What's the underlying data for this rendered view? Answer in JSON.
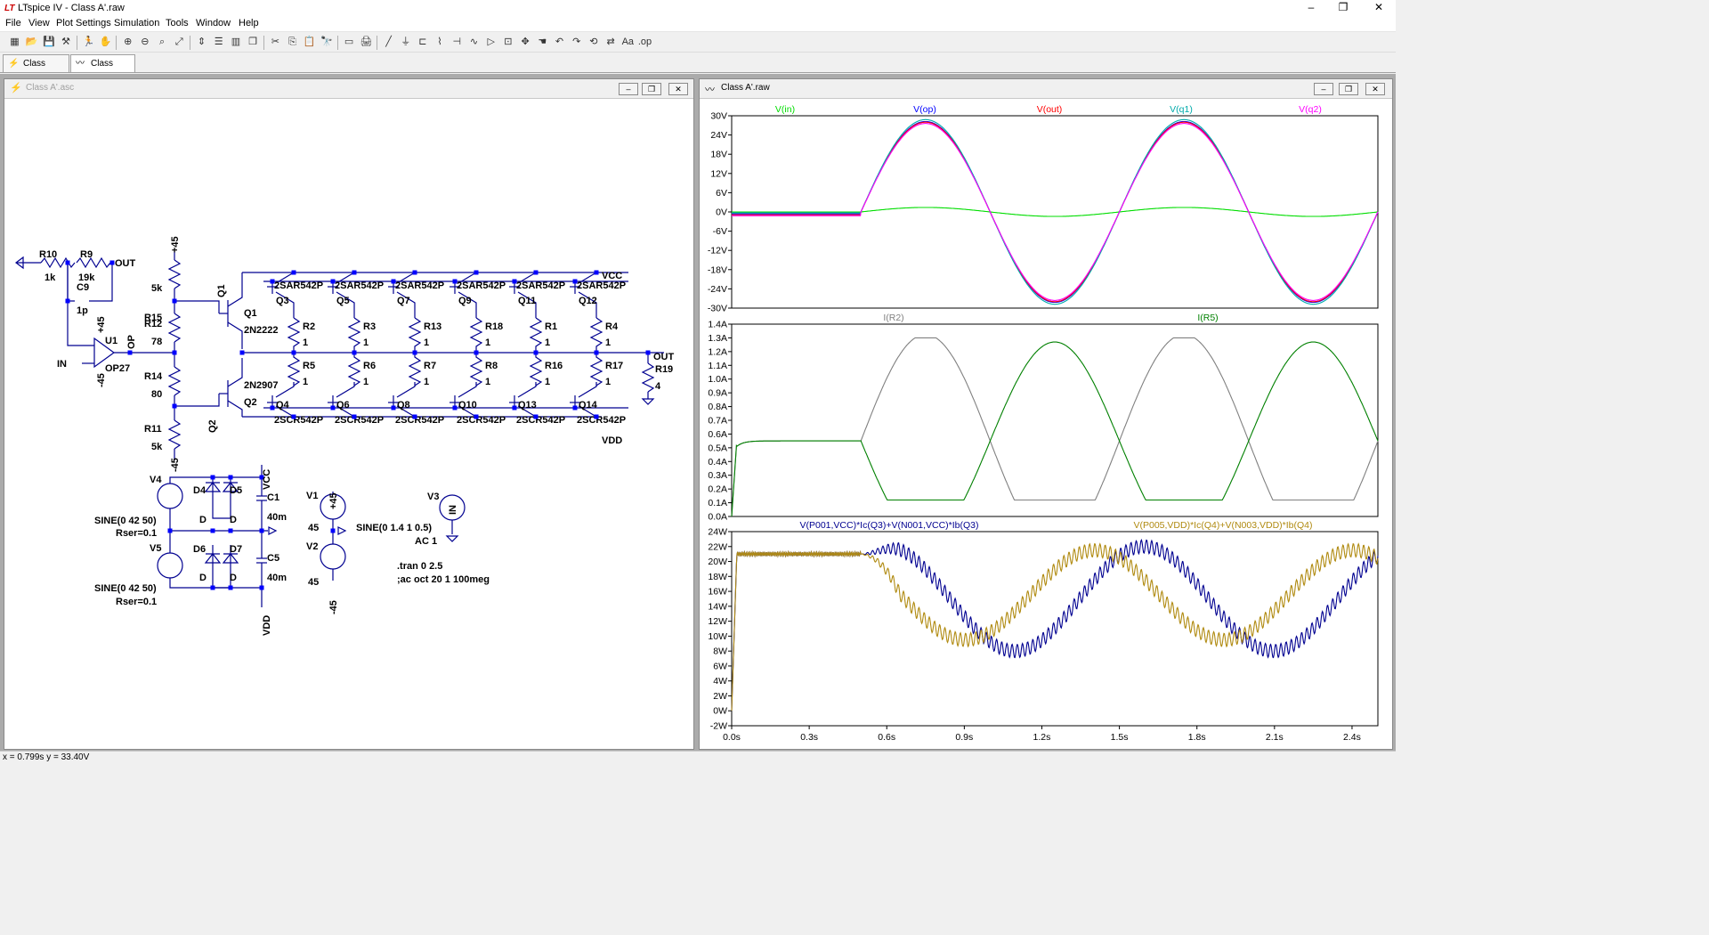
{
  "app": {
    "title": "LTspice IV - Class A'.raw",
    "logo": "LT"
  },
  "window_controls": {
    "minimize": "–",
    "maximize": "❐",
    "close": "✕"
  },
  "menu": [
    "File",
    "View",
    "Plot Settings",
    "Simulation",
    "Tools",
    "Window",
    "Help"
  ],
  "toolbar_icons": [
    "new-schematic-icon",
    "open-icon",
    "save-icon",
    "control-panel-icon",
    "run-icon",
    "halt-icon",
    "zoom-in-icon",
    "zoom-out-icon",
    "zoom-area-icon",
    "zoom-fit-icon",
    "autorange-icon",
    "tile-horizontal-icon",
    "tile-vertical-icon",
    "cascade-icon",
    "cut-icon",
    "copy-icon",
    "paste-icon",
    "find-icon",
    "print-setup-icon",
    "print-icon",
    "wire-icon",
    "ground-icon",
    "label-icon",
    "resistor-icon",
    "capacitor-icon",
    "inductor-icon",
    "diode-icon",
    "component-icon",
    "move-icon",
    "drag-icon",
    "undo-icon",
    "redo-icon",
    "rotate-icon",
    "mirror-icon",
    "text-icon",
    "spice-directive-icon"
  ],
  "tabs": [
    {
      "label": "Class A'.asc",
      "icon": "schematic-tab-icon"
    },
    {
      "label": "Class A'.raw",
      "icon": "waveform-tab-icon"
    }
  ],
  "schematic_window": {
    "title": "Class A'.asc",
    "labels": {
      "R10": "R10",
      "R10v": "1k",
      "R9": "R9",
      "R9v": "19k",
      "C9": "C9",
      "C9v": "1p",
      "OUT": "OUT",
      "IN": "IN",
      "U1": "U1",
      "OP27": "OP27",
      "OP": "OP",
      "p45": "+45",
      "m45": "-45",
      "R15": "R15",
      "R15v": "5k",
      "R12": "R12",
      "R12v": "78",
      "R14": "R14",
      "R14v": "80",
      "R11": "R11",
      "R11v": "5k",
      "Q1": "Q1",
      "Q1m": "2N2222",
      "Q2": "Q2",
      "Q2m": "2N2907",
      "VCC": "VCC",
      "VDD": "VDD",
      "npn": "2SAR542P",
      "pnp": "2SCR542P",
      "one": "1",
      "V4": "V4",
      "V5": "V5",
      "D4": "D4",
      "D5": "D5",
      "D6": "D6",
      "D7": "D7",
      "D": "D",
      "sine42": "SINE(0 42 50)",
      "rser": "Rser=0.1",
      "C1": "C1",
      "C5": "C5",
      "c40m": "40m",
      "V1": "V1",
      "V2": "V2",
      "v45": "45",
      "V3": "V3",
      "sine14": "SINE(0 1.4 1 0.5)",
      "ac1": "AC 1",
      "tran": ".tran 0 2.5",
      "acdir": ";ac oct 20 1 100meg",
      "R19": "R19",
      "R19v": "4"
    },
    "top_q": [
      "Q3",
      "Q5",
      "Q7",
      "Q9",
      "Q11",
      "Q12"
    ],
    "bot_q": [
      "Q4",
      "Q6",
      "Q8",
      "Q10",
      "Q13",
      "Q14"
    ],
    "top_r": [
      "R2",
      "R3",
      "R13",
      "R18",
      "R1",
      "R4"
    ],
    "bot_r": [
      "R5",
      "R6",
      "R7",
      "R8",
      "R16",
      "R17"
    ]
  },
  "waveform_window": {
    "title": "Class A'.raw"
  },
  "chart_data": [
    {
      "type": "line",
      "series": [
        {
          "name": "V(in)",
          "color": "#00dd00",
          "shape": "sine",
          "amplitude": 1.4,
          "offset": 0,
          "start": 0.5,
          "freq": 1,
          "pre": 0
        },
        {
          "name": "V(op)",
          "color": "#0000ff",
          "shape": "sine",
          "amplitude": 28.2,
          "offset": 0,
          "start": 0.5,
          "freq": 1,
          "pre": -0.6
        },
        {
          "name": "V(out)",
          "color": "#ff0000",
          "shape": "sine",
          "amplitude": 28,
          "offset": 0,
          "start": 0.5,
          "freq": 1,
          "pre": -0.9
        },
        {
          "name": "V(q1)",
          "color": "#00aaaa",
          "shape": "sine",
          "amplitude": 28.8,
          "offset": 0,
          "start": 0.5,
          "freq": 1,
          "pre": -0.3
        },
        {
          "name": "V(q2)",
          "color": "#ff00ff",
          "shape": "sine",
          "amplitude": 27.6,
          "offset": 0,
          "start": 0.5,
          "freq": 1,
          "pre": -1.2
        }
      ],
      "ylim": [
        -30,
        30
      ],
      "yticks": [
        "30V",
        "24V",
        "18V",
        "12V",
        "6V",
        "0V",
        "-6V",
        "-12V",
        "-18V",
        "-24V",
        "-30V"
      ],
      "xlim": [
        0,
        2.5
      ],
      "grid": false
    },
    {
      "type": "line",
      "series": [
        {
          "name": "I(R2)",
          "color": "#808080",
          "shape": "sine",
          "amplitude": 0.775,
          "offset": 0.55,
          "start": 0.5,
          "freq": 1,
          "pre": 0.55,
          "invert": false
        },
        {
          "name": "I(R5)",
          "color": "#008000",
          "shape": "sine",
          "amplitude": 0.72,
          "offset": 0.55,
          "start": 0.5,
          "freq": 1,
          "pre": 0.55,
          "invert": true
        }
      ],
      "ylim": [
        0,
        1.4
      ],
      "yticks": [
        "1.4A",
        "1.3A",
        "1.2A",
        "1.1A",
        "1.0A",
        "0.9A",
        "0.8A",
        "0.7A",
        "0.6A",
        "0.5A",
        "0.4A",
        "0.3A",
        "0.2A",
        "0.1A",
        "0.0A"
      ],
      "xlim": [
        0,
        2.5
      ],
      "grid": false
    },
    {
      "type": "line",
      "series": [
        {
          "name": "V(P001,VCC)*Ic(Q3)+V(N001,VCC)*Ib(Q3)",
          "color": "#000090",
          "shape": "power",
          "mid": 15,
          "amp": 7,
          "phase": -0.6,
          "pre": 21,
          "start": 0.5
        },
        {
          "name": "V(P005,VDD)*Ic(Q4)+V(N003,VDD)*Ib(Q4)",
          "color": "#b08a10",
          "shape": "power",
          "mid": 15.5,
          "amp": 6,
          "phase": 0.6,
          "pre": 21,
          "start": 0.5
        }
      ],
      "ylim": [
        -2,
        24
      ],
      "yticks": [
        "24W",
        "22W",
        "20W",
        "18W",
        "16W",
        "14W",
        "12W",
        "10W",
        "8W",
        "6W",
        "4W",
        "2W",
        "0W",
        "-2W"
      ],
      "xlim": [
        0,
        2.5
      ],
      "xticks": [
        "0.0s",
        "0.3s",
        "0.6s",
        "0.9s",
        "1.2s",
        "1.5s",
        "1.8s",
        "2.1s",
        "2.4s"
      ],
      "xtick_values": [
        0,
        0.3,
        0.6,
        0.9,
        1.2,
        1.5,
        1.8,
        2.1,
        2.4
      ],
      "grid": false
    }
  ],
  "status": {
    "text": "x = 0.799s   y = 33.40V"
  }
}
